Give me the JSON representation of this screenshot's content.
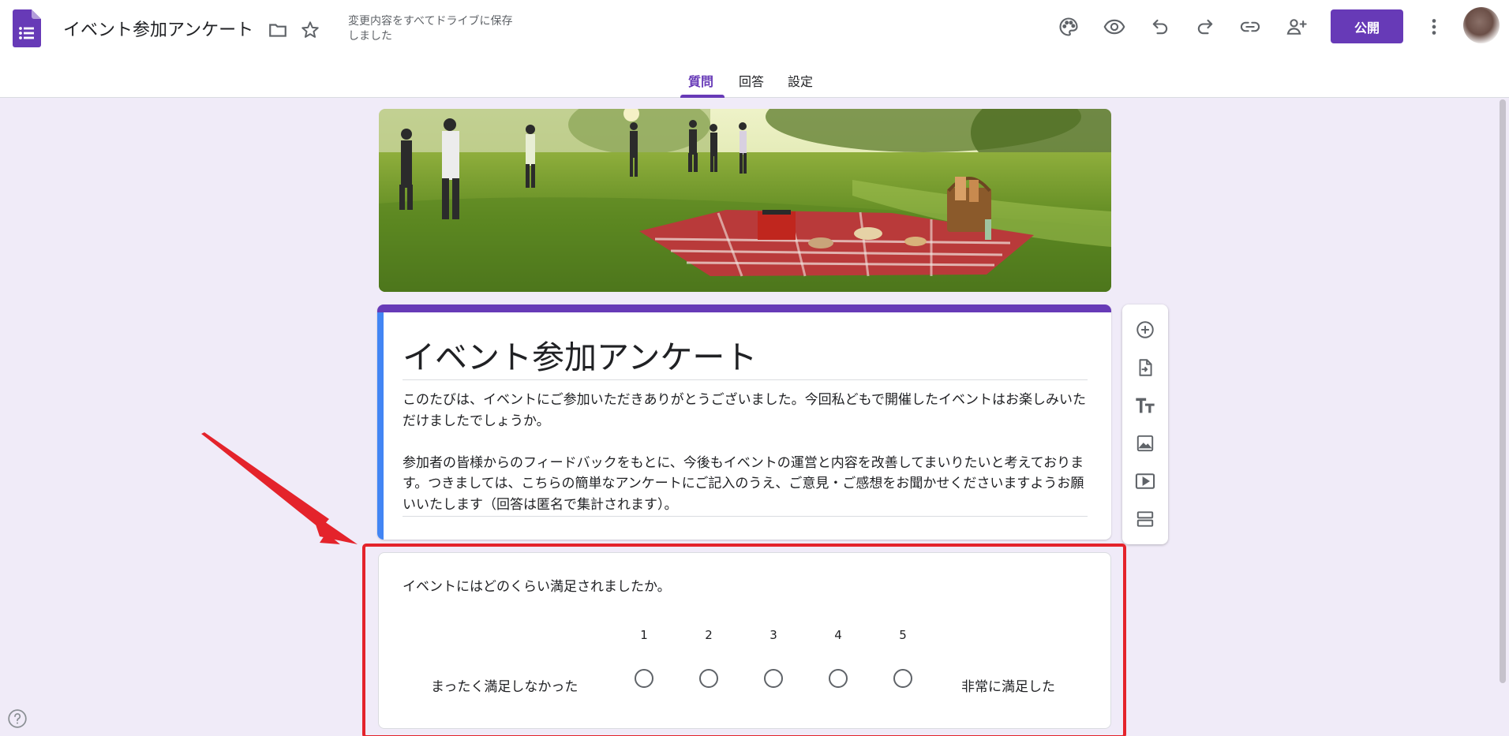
{
  "header": {
    "doc_title": "イベント参加アンケート",
    "save_status": "変更内容をすべてドライブに保存しました",
    "publish_label": "公開",
    "icons": [
      "forms-logo",
      "folder-icon",
      "star-icon",
      "palette-icon",
      "preview-icon",
      "undo-icon",
      "redo-icon",
      "link-icon",
      "add-collaborator-icon",
      "more-vert-icon"
    ]
  },
  "tabs": [
    {
      "label": "質問",
      "active": true
    },
    {
      "label": "回答",
      "active": false
    },
    {
      "label": "設定",
      "active": false
    }
  ],
  "form": {
    "title": "イベント参加アンケート",
    "description": [
      "このたびは、イベントにご参加いただきありがとうございました。今回私どもで開催したイベントはお楽しみいただけましたでしょうか。",
      "参加者の皆様からのフィードバックをもとに、今後もイベントの運営と内容を改善してまいりたいと考えております。つきましては、こちらの簡単なアンケートにご記入のうえ、ご意見・ご感想をお聞かせくださいますようお願いいたします（回答は匿名で集計されます）。"
    ]
  },
  "question": {
    "title": "イベントにはどのくらい満足されましたか。",
    "scale": [
      "1",
      "2",
      "3",
      "4",
      "5"
    ],
    "low_label": "まったく満足しなかった",
    "high_label": "非常に満足した"
  },
  "side_toolbar": [
    "add-question-icon",
    "import-questions-icon",
    "add-title-icon",
    "add-image-icon",
    "add-video-icon",
    "add-section-icon"
  ],
  "colors": {
    "accent": "#673ab7",
    "background": "#f0ebf8",
    "highlight": "#e4232b",
    "description_strip": "#4285f4"
  }
}
